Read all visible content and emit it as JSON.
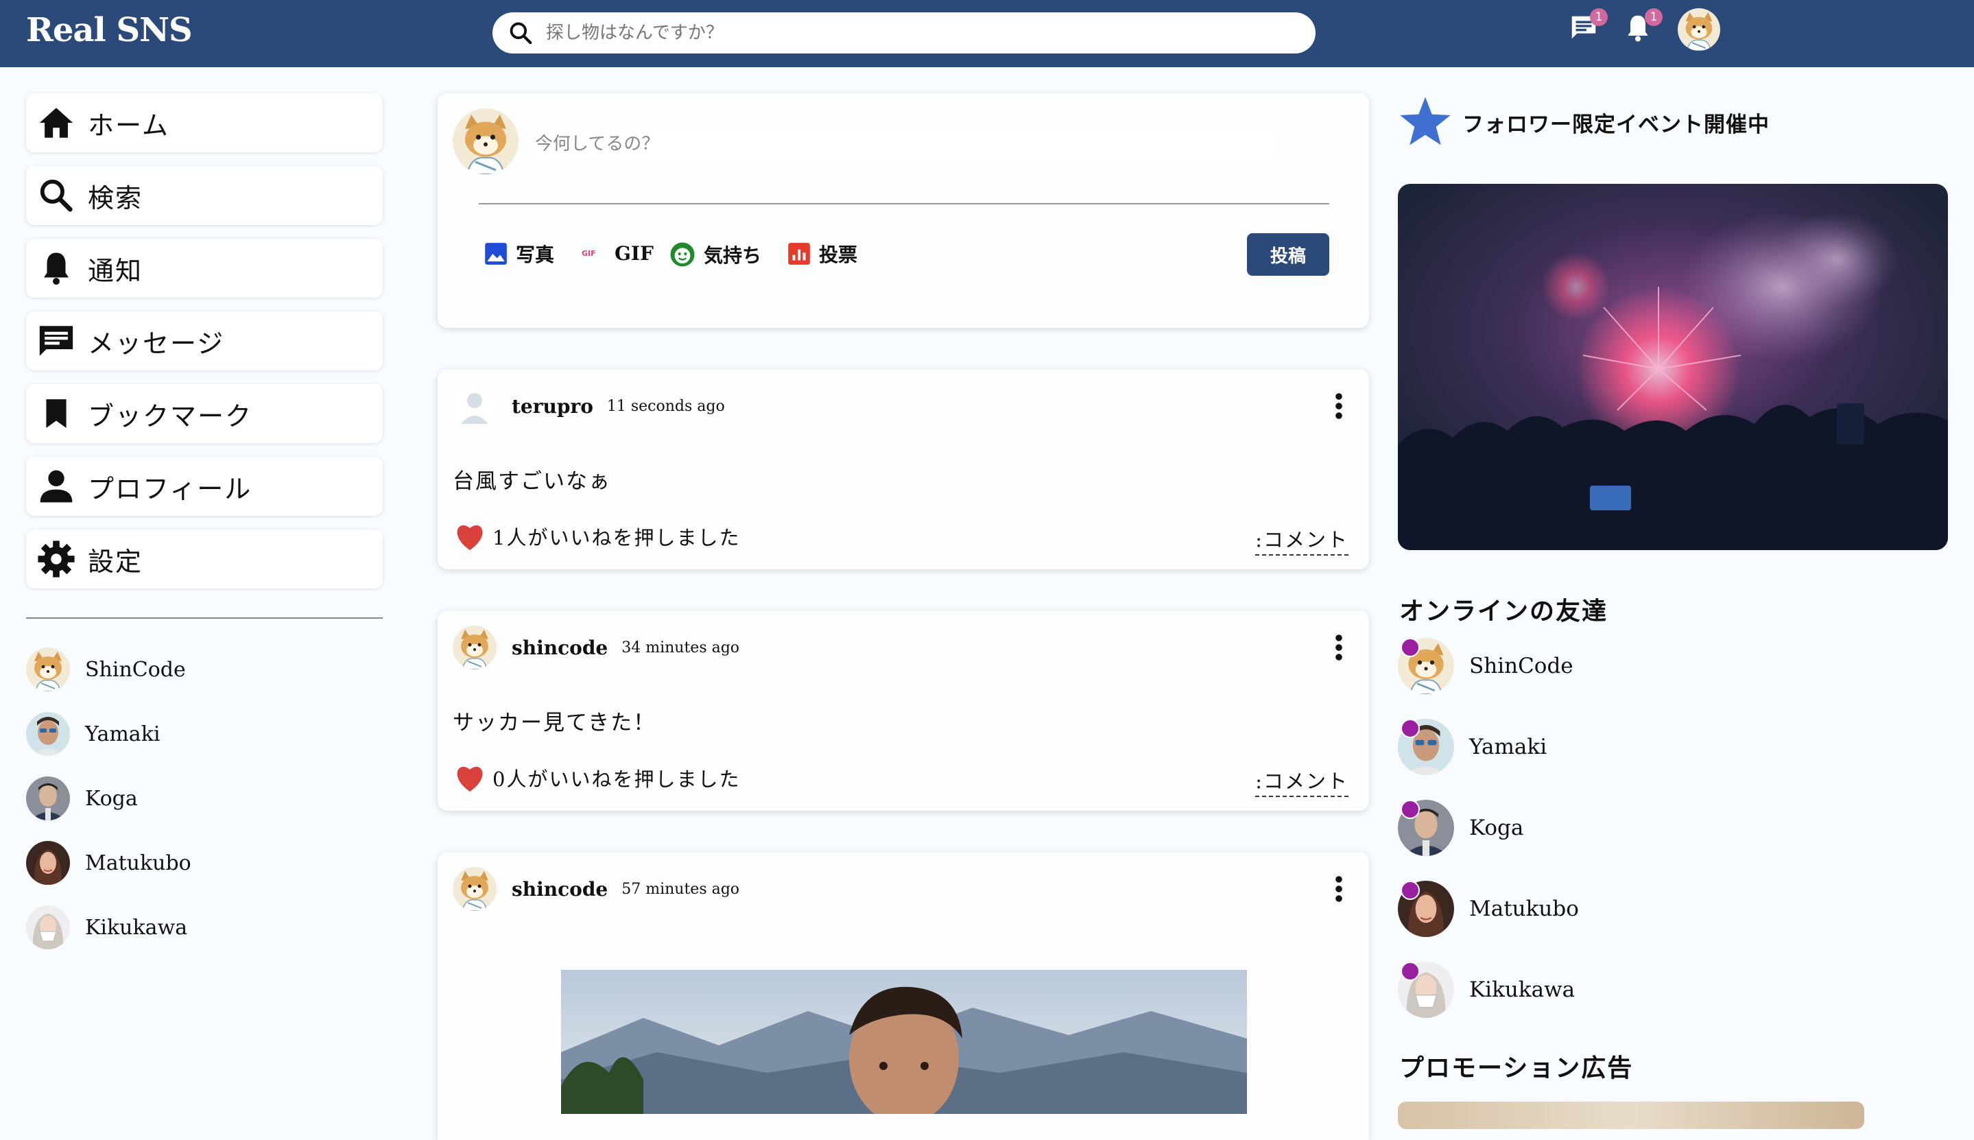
{
  "app": {
    "title": "Real SNS"
  },
  "search": {
    "placeholder": "探し物はなんですか？"
  },
  "topbar": {
    "chat_badge": "1",
    "notify_badge": "1"
  },
  "sidebar": {
    "items": [
      {
        "label": "ホーム",
        "icon": "home-icon"
      },
      {
        "label": "検索",
        "icon": "search-icon"
      },
      {
        "label": "通知",
        "icon": "bell-icon"
      },
      {
        "label": "メッセージ",
        "icon": "chat-icon"
      },
      {
        "label": "ブックマーク",
        "icon": "bookmark-icon"
      },
      {
        "label": "プロフィール",
        "icon": "person-icon"
      },
      {
        "label": "設定",
        "icon": "gear-icon"
      }
    ],
    "friends": [
      "ShinCode",
      "Yamaki",
      "Koga",
      "Matukubo",
      "Kikukawa"
    ]
  },
  "share": {
    "placeholder": "今何してるの？",
    "options": {
      "photo": "写真",
      "gif": "GIF",
      "feeling": "気持ち",
      "vote": "投票"
    },
    "post_button": "投稿"
  },
  "posts": [
    {
      "user": "terupro",
      "date": "11 seconds ago",
      "text": "台風すごいなぁ",
      "likes": "1人がいいねを押しました",
      "comment": ":コメント"
    },
    {
      "user": "shincode",
      "date": "34 minutes ago",
      "text": "サッカー見てきた！",
      "likes": "0人がいいねを押しました",
      "comment": ":コメント"
    },
    {
      "user": "shincode",
      "date": "57 minutes ago"
    }
  ],
  "rightbar": {
    "event_text": "フォロワー限定イベント開催中",
    "online_title": "オンラインの友達",
    "online": [
      "ShinCode",
      "Yamaki",
      "Koga",
      "Matukubo",
      "Kikukawa"
    ],
    "promo_title": "プロモーション広告"
  },
  "colors": {
    "brand": "#2b4a7a",
    "badge": "#d1689e",
    "online_dot": "#9a1fa0",
    "like": "#d9413a"
  }
}
